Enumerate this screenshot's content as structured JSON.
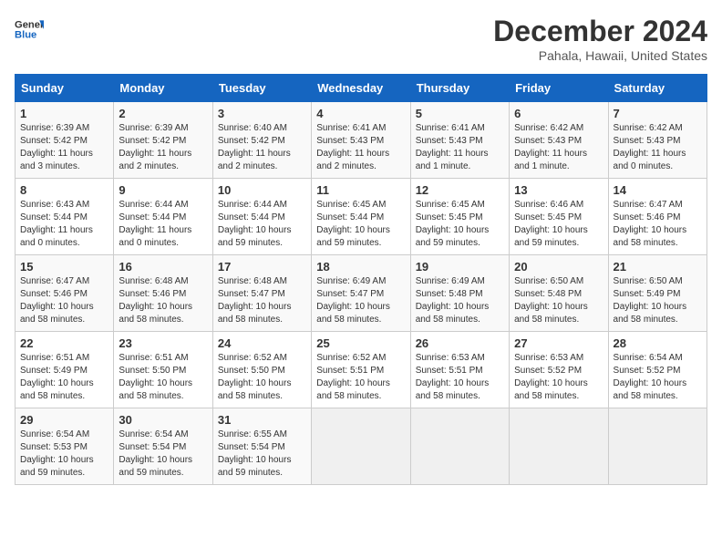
{
  "logo": {
    "line1": "General",
    "line2": "Blue"
  },
  "title": "December 2024",
  "subtitle": "Pahala, Hawaii, United States",
  "weekdays": [
    "Sunday",
    "Monday",
    "Tuesday",
    "Wednesday",
    "Thursday",
    "Friday",
    "Saturday"
  ],
  "weeks": [
    [
      {
        "day": "1",
        "sunrise": "6:39 AM",
        "sunset": "5:42 PM",
        "daylight": "11 hours and 3 minutes."
      },
      {
        "day": "2",
        "sunrise": "6:39 AM",
        "sunset": "5:42 PM",
        "daylight": "11 hours and 2 minutes."
      },
      {
        "day": "3",
        "sunrise": "6:40 AM",
        "sunset": "5:42 PM",
        "daylight": "11 hours and 2 minutes."
      },
      {
        "day": "4",
        "sunrise": "6:41 AM",
        "sunset": "5:43 PM",
        "daylight": "11 hours and 2 minutes."
      },
      {
        "day": "5",
        "sunrise": "6:41 AM",
        "sunset": "5:43 PM",
        "daylight": "11 hours and 1 minute."
      },
      {
        "day": "6",
        "sunrise": "6:42 AM",
        "sunset": "5:43 PM",
        "daylight": "11 hours and 1 minute."
      },
      {
        "day": "7",
        "sunrise": "6:42 AM",
        "sunset": "5:43 PM",
        "daylight": "11 hours and 0 minutes."
      }
    ],
    [
      {
        "day": "8",
        "sunrise": "6:43 AM",
        "sunset": "5:44 PM",
        "daylight": "11 hours and 0 minutes."
      },
      {
        "day": "9",
        "sunrise": "6:44 AM",
        "sunset": "5:44 PM",
        "daylight": "11 hours and 0 minutes."
      },
      {
        "day": "10",
        "sunrise": "6:44 AM",
        "sunset": "5:44 PM",
        "daylight": "10 hours and 59 minutes."
      },
      {
        "day": "11",
        "sunrise": "6:45 AM",
        "sunset": "5:44 PM",
        "daylight": "10 hours and 59 minutes."
      },
      {
        "day": "12",
        "sunrise": "6:45 AM",
        "sunset": "5:45 PM",
        "daylight": "10 hours and 59 minutes."
      },
      {
        "day": "13",
        "sunrise": "6:46 AM",
        "sunset": "5:45 PM",
        "daylight": "10 hours and 59 minutes."
      },
      {
        "day": "14",
        "sunrise": "6:47 AM",
        "sunset": "5:46 PM",
        "daylight": "10 hours and 58 minutes."
      }
    ],
    [
      {
        "day": "15",
        "sunrise": "6:47 AM",
        "sunset": "5:46 PM",
        "daylight": "10 hours and 58 minutes."
      },
      {
        "day": "16",
        "sunrise": "6:48 AM",
        "sunset": "5:46 PM",
        "daylight": "10 hours and 58 minutes."
      },
      {
        "day": "17",
        "sunrise": "6:48 AM",
        "sunset": "5:47 PM",
        "daylight": "10 hours and 58 minutes."
      },
      {
        "day": "18",
        "sunrise": "6:49 AM",
        "sunset": "5:47 PM",
        "daylight": "10 hours and 58 minutes."
      },
      {
        "day": "19",
        "sunrise": "6:49 AM",
        "sunset": "5:48 PM",
        "daylight": "10 hours and 58 minutes."
      },
      {
        "day": "20",
        "sunrise": "6:50 AM",
        "sunset": "5:48 PM",
        "daylight": "10 hours and 58 minutes."
      },
      {
        "day": "21",
        "sunrise": "6:50 AM",
        "sunset": "5:49 PM",
        "daylight": "10 hours and 58 minutes."
      }
    ],
    [
      {
        "day": "22",
        "sunrise": "6:51 AM",
        "sunset": "5:49 PM",
        "daylight": "10 hours and 58 minutes."
      },
      {
        "day": "23",
        "sunrise": "6:51 AM",
        "sunset": "5:50 PM",
        "daylight": "10 hours and 58 minutes."
      },
      {
        "day": "24",
        "sunrise": "6:52 AM",
        "sunset": "5:50 PM",
        "daylight": "10 hours and 58 minutes."
      },
      {
        "day": "25",
        "sunrise": "6:52 AM",
        "sunset": "5:51 PM",
        "daylight": "10 hours and 58 minutes."
      },
      {
        "day": "26",
        "sunrise": "6:53 AM",
        "sunset": "5:51 PM",
        "daylight": "10 hours and 58 minutes."
      },
      {
        "day": "27",
        "sunrise": "6:53 AM",
        "sunset": "5:52 PM",
        "daylight": "10 hours and 58 minutes."
      },
      {
        "day": "28",
        "sunrise": "6:54 AM",
        "sunset": "5:52 PM",
        "daylight": "10 hours and 58 minutes."
      }
    ],
    [
      {
        "day": "29",
        "sunrise": "6:54 AM",
        "sunset": "5:53 PM",
        "daylight": "10 hours and 59 minutes."
      },
      {
        "day": "30",
        "sunrise": "6:54 AM",
        "sunset": "5:54 PM",
        "daylight": "10 hours and 59 minutes."
      },
      {
        "day": "31",
        "sunrise": "6:55 AM",
        "sunset": "5:54 PM",
        "daylight": "10 hours and 59 minutes."
      },
      null,
      null,
      null,
      null
    ]
  ],
  "labels": {
    "sunrise": "Sunrise:",
    "sunset": "Sunset:",
    "daylight": "Daylight:"
  }
}
